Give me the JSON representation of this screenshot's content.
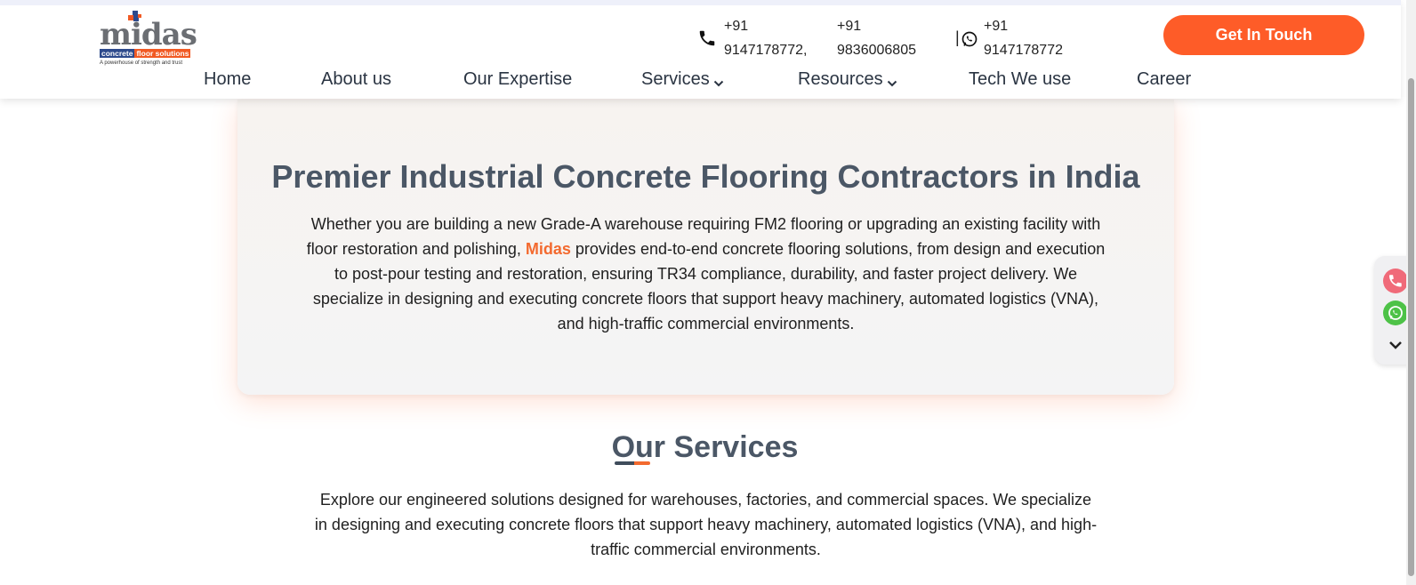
{
  "header": {
    "logo": {
      "word": "midas",
      "sub_a": "concrete",
      "sub_b": "floor solutions",
      "tagline": "A powerhouse of strength and trust"
    },
    "contacts": [
      {
        "icon": "phone-icon",
        "prefix": "+91",
        "number": "9147178772,"
      },
      {
        "prefix": "+91",
        "number": "9836006805"
      },
      {
        "icon": "whatsapp-icon",
        "prefix": "+91",
        "number": "9147178772"
      }
    ],
    "cta_label": "Get In Touch",
    "separator": "|"
  },
  "nav": {
    "items": [
      {
        "label": "Home"
      },
      {
        "label": "About us"
      },
      {
        "label": "Our Expertise"
      },
      {
        "label": "Services",
        "icon": "chevron-down-icon"
      },
      {
        "label": "Resources",
        "icon": "chevron-down-icon"
      },
      {
        "label": "Tech We use"
      },
      {
        "label": "Career"
      }
    ]
  },
  "hero": {
    "title": "Premier Industrial Concrete Flooring Contractors in India",
    "text_before": "Whether you are building a new Grade-A warehouse requiring FM2 flooring or upgrading an existing facility with floor restoration and polishing, ",
    "brand": "Midas",
    "text_after": " provides end-to-end concrete flooring solutions, from design and execution to post-pour testing and restoration, ensuring TR34 compliance, durability, and faster project delivery. We specialize in designing and executing concrete floors that support heavy machinery, automated logistics (VNA), and high-traffic commercial environments."
  },
  "services": {
    "title": "Our Services",
    "text": "Explore our engineered solutions designed for warehouses, factories, and commercial spaces. We specialize in designing and executing concrete floors that support heavy machinery, automated logistics (VNA), and high-traffic commercial environments."
  },
  "floating": {
    "buttons": [
      "phone-icon",
      "whatsapp-icon",
      "chevron-down-icon"
    ]
  },
  "colors": {
    "accent": "#fe5c28",
    "heading": "#4b5766",
    "nav_text": "#2a3442"
  }
}
